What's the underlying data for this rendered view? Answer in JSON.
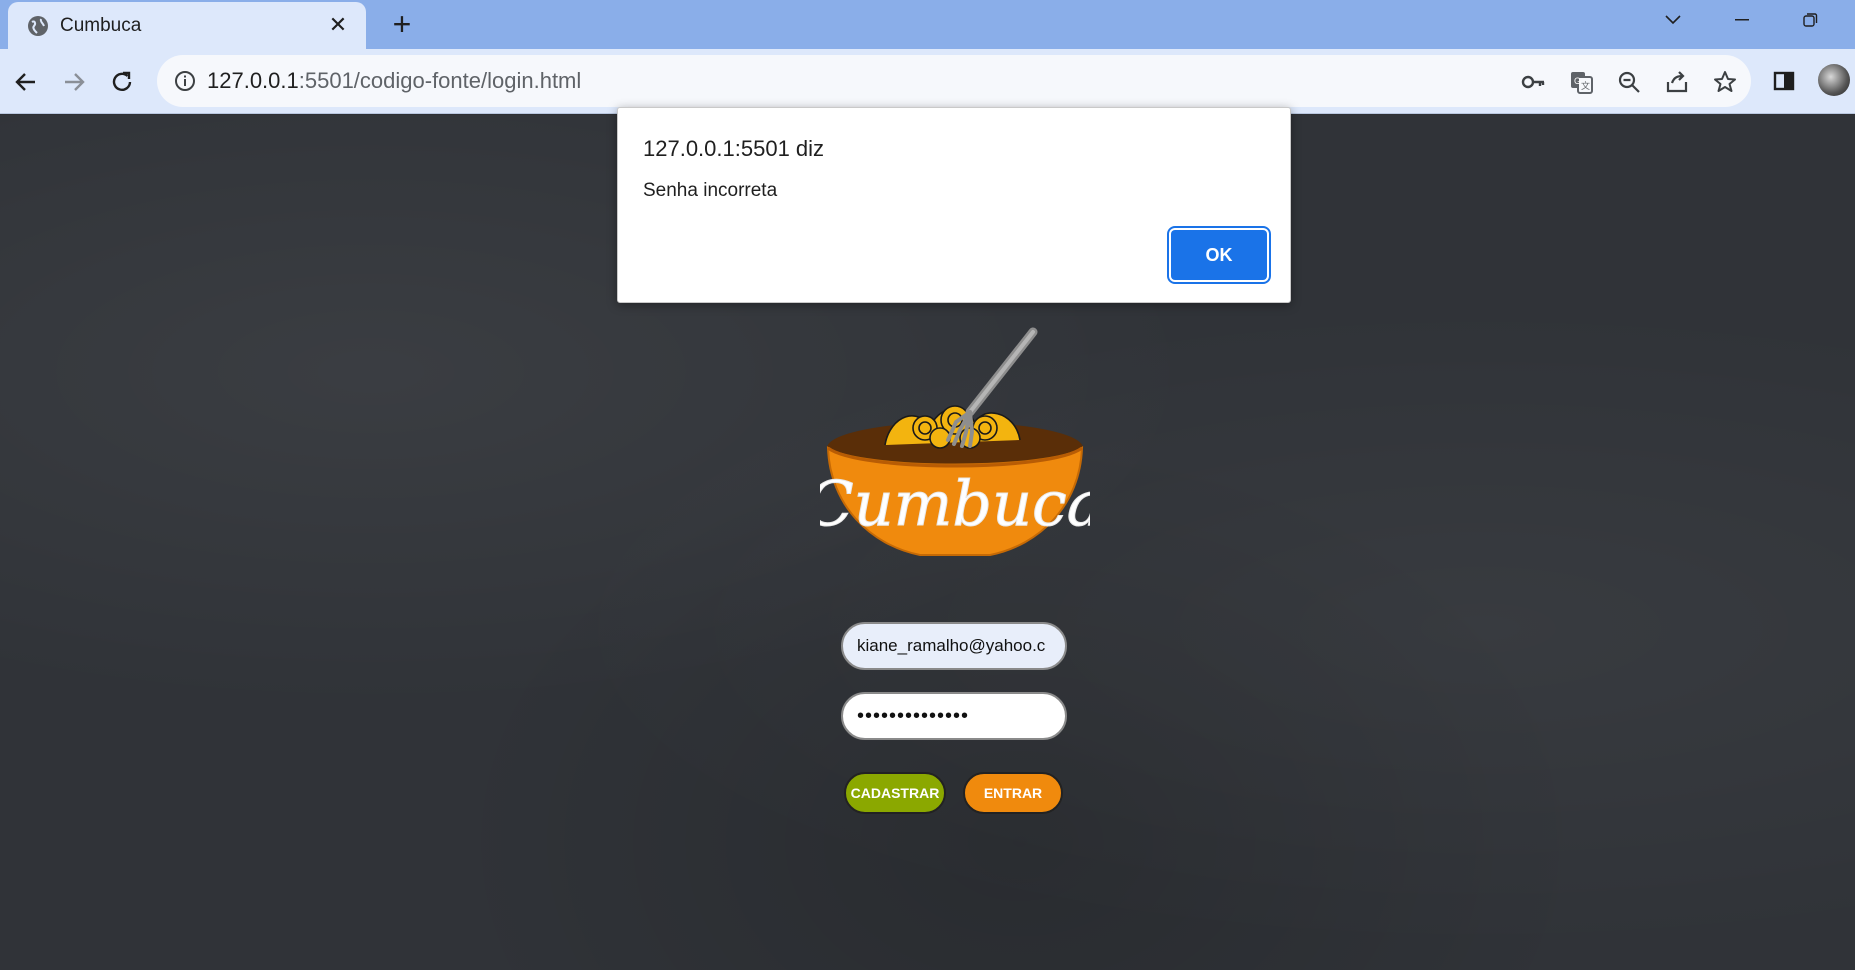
{
  "browser": {
    "tab": {
      "title": "Cumbuca"
    },
    "address": {
      "host": "127.0.0.1",
      "rest": ":5501/codigo-fonte/login.html"
    },
    "icons": [
      "globe-icon",
      "close-icon",
      "plus-icon",
      "back-icon",
      "forward-icon",
      "reload-icon",
      "info-icon",
      "key-icon",
      "translate-icon",
      "zoom-out-icon",
      "share-icon",
      "star-icon",
      "sidepanel-icon",
      "avatar"
    ]
  },
  "dialog": {
    "title": "127.0.0.1:5501 diz",
    "message": "Senha incorreta",
    "ok_label": "OK"
  },
  "login": {
    "logo_text": "Cumbuca",
    "email_value": "kiane_ramalho@yahoo.c",
    "password_value": "••••••••••••••",
    "register_label": "CADASTRAR",
    "enter_label": "ENTRAR"
  },
  "colors": {
    "accent_orange": "#f08a0d",
    "accent_green": "#8ba800",
    "dialog_button": "#1a73e8",
    "page_bg": "#303338"
  }
}
